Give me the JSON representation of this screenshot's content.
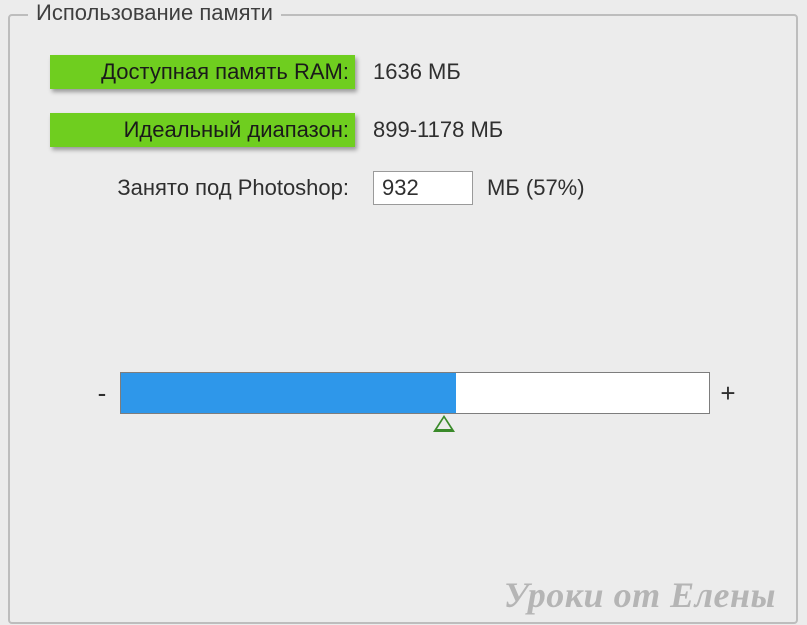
{
  "group_title": "Использование памяти",
  "rows": {
    "available_ram_label": "Доступная память RAM:",
    "available_ram_value": "1636 МБ",
    "ideal_range_label": "Идеальный диапазон:",
    "ideal_range_value": "899-1178 МБ",
    "photoshop_usage_label": "Занято под Photoshop:",
    "photoshop_usage_input": "932",
    "photoshop_usage_unit": "МБ (57%)"
  },
  "slider": {
    "minus": "-",
    "plus": "+",
    "percent": 57,
    "handle_percent": 55
  },
  "watermark": "Уроки от Елены"
}
